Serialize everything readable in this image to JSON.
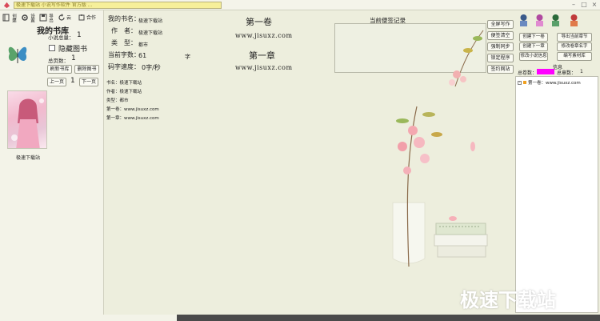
{
  "window": {
    "title": "极速下载站 小说写作软件 官方版 ...",
    "minimize_icon": "minimize-icon",
    "maximize_icon": "maximize-icon",
    "close_icon": "close-icon"
  },
  "toolbar": {
    "create_label": "创建",
    "settings_label": "设置",
    "export_label": "导出",
    "refresh_label": "云",
    "merge_label": "合作"
  },
  "library": {
    "title": "我的书库",
    "total_label": "小说总量：",
    "total_value": "1",
    "hide_label": "隐藏图书",
    "pages_label": "总页数：",
    "pages_value": "1",
    "refresh_btn": "刷新书库",
    "delete_btn": "删除图书",
    "prev_btn": "上一页",
    "page_value": "1",
    "next_btn": "下一页",
    "cover_caption": "极速下载站"
  },
  "book": {
    "name_label": "我的书名：",
    "name_value": "极速下载站",
    "author_label": "作　者：",
    "author_value": "极速下载站",
    "type_label": "类　型：",
    "type_value": "都市",
    "words_label": "当前字数：",
    "words_value": "61",
    "words_unit": "字",
    "speed_label": "码字速度：",
    "speed_value": "0字/秒",
    "meta": [
      "书名：极速下载站",
      "作者：极速下载站",
      "类型：都市",
      "第一卷：www.jisuxz.com",
      "第一章：www.jisuxz.com"
    ]
  },
  "content": {
    "volume_title": "第一卷",
    "volume_url": "www.jisuxz.com",
    "chapter_title": "第一章",
    "chapter_url": "www.jisuxz.com"
  },
  "notes": {
    "title": "当前便签记录",
    "buttons": [
      "全屏写作",
      "便签清空",
      "强制同步",
      "锁定程序",
      "签约网站"
    ]
  },
  "right_panel": {
    "buttons": [
      [
        "创建下一卷",
        "导出当前章节"
      ],
      [
        "创建下一章",
        "修改卷章名字"
      ],
      [
        "修改小说信息",
        "编写素材库"
      ]
    ],
    "info_label": "信息",
    "total_volumes_label": "总卷数：",
    "total_chapters_label": "总章数：",
    "total_chapters_value": "1",
    "tree_item": "第一卷：www.jisuxz.com"
  },
  "watermark": "极速下载站",
  "colors": {
    "background": "#edeedd",
    "title_box": "#f6ef9a",
    "progress_magenta": "#ff00ff"
  }
}
